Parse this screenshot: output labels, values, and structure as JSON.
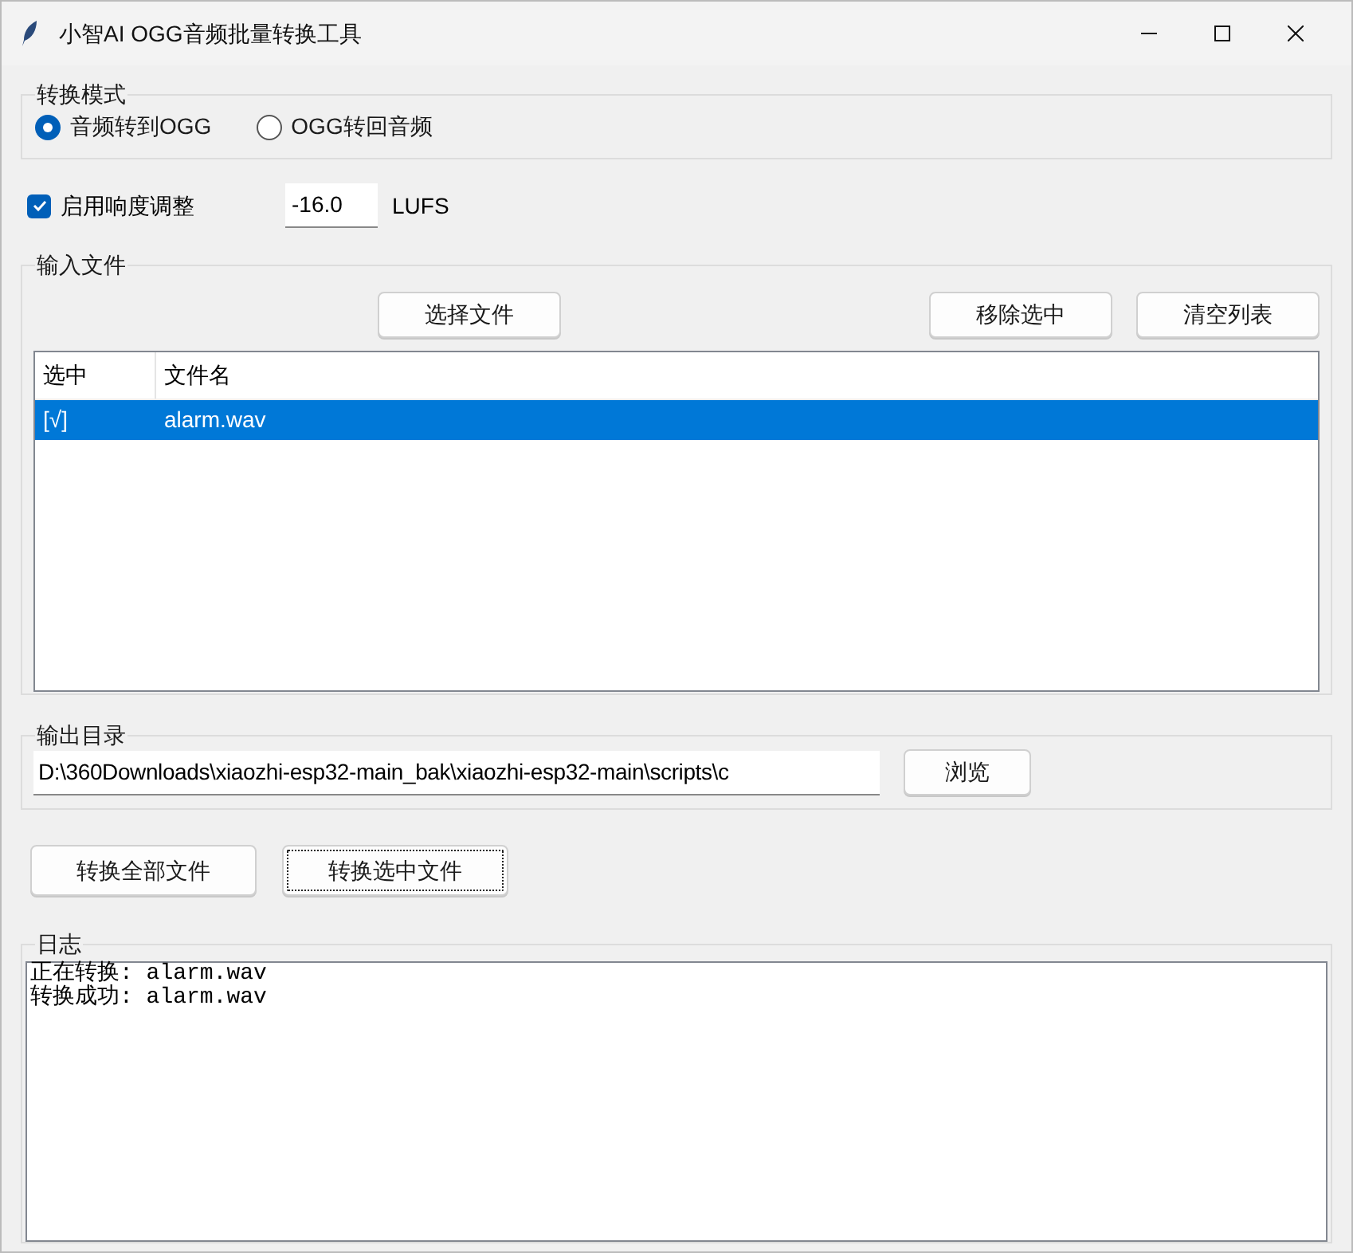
{
  "window": {
    "title": "小智AI OGG音频批量转换工具"
  },
  "mode_group": {
    "label": "转换模式",
    "options": [
      {
        "label": "音频转到OGG",
        "selected": true
      },
      {
        "label": "OGG转回音频",
        "selected": false
      }
    ]
  },
  "loudness": {
    "label": "启用响度调整",
    "checked": true,
    "value": "-16.0",
    "unit": "LUFS"
  },
  "input_group": {
    "label": "输入文件",
    "buttons": [
      "选择文件",
      "移除选中",
      "清空列表"
    ],
    "table": {
      "columns": [
        "选中",
        "文件名"
      ],
      "rows": [
        {
          "cells": [
            "[√]",
            "alarm.wav"
          ],
          "selected": true
        }
      ]
    }
  },
  "output_group": {
    "label": "输出目录",
    "path": "D:\\360Downloads\\xiaozhi-esp32-main_bak\\xiaozhi-esp32-main\\scripts\\c",
    "browse": "浏览"
  },
  "actions": [
    {
      "label": "转换全部文件",
      "focused": false
    },
    {
      "label": "转换选中文件",
      "focused": true
    }
  ],
  "log": {
    "label": "日志",
    "lines": [
      "正在转换: alarm.wav",
      "转换成功: alarm.wav"
    ]
  }
}
